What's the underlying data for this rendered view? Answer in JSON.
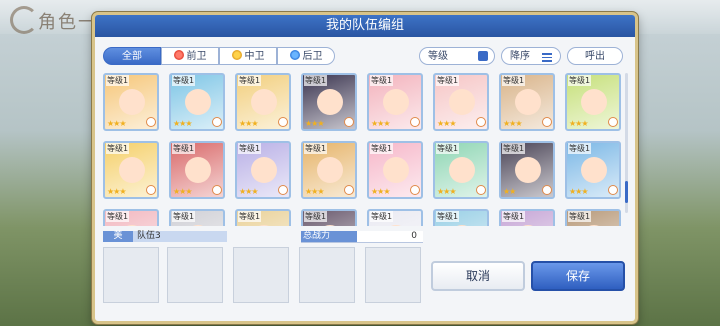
{
  "background": {
    "title": "角色一览"
  },
  "dialog": {
    "title": "我的队伍编组"
  },
  "filters": {
    "all": "全部",
    "front": "前卫",
    "mid": "中卫",
    "back": "后卫"
  },
  "controls": {
    "level_sort": "等级",
    "order": "降序",
    "call": "呼出"
  },
  "cards": {
    "r1": [
      {
        "level": "等级1",
        "stars": "★★★",
        "color": "#f6c77a"
      },
      {
        "level": "等级1",
        "stars": "★★★",
        "color": "#7fc6e6"
      },
      {
        "level": "等级1",
        "stars": "★★★",
        "color": "#f2cf7e"
      },
      {
        "level": "等级1",
        "stars": "★★★",
        "color": "#3b3550"
      },
      {
        "level": "等级1",
        "stars": "★★★",
        "color": "#f3b3bd"
      },
      {
        "level": "等级1",
        "stars": "★★★",
        "color": "#f6c6c6"
      },
      {
        "level": "等级1",
        "stars": "★★★",
        "color": "#d9b48a"
      },
      {
        "level": "等级1",
        "stars": "★★★",
        "color": "#c6e07a"
      }
    ],
    "r2": [
      {
        "level": "等级1",
        "stars": "★★★",
        "color": "#f5d06a"
      },
      {
        "level": "等级1",
        "stars": "★★★",
        "color": "#d96a6a"
      },
      {
        "level": "等级1",
        "stars": "★★★",
        "color": "#b9b0e6"
      },
      {
        "level": "等级1",
        "stars": "★★★",
        "color": "#e6b46a"
      },
      {
        "level": "等级1",
        "stars": "★★★",
        "color": "#f6b7c9"
      },
      {
        "level": "等级1",
        "stars": "★★★",
        "color": "#8fd6b4"
      },
      {
        "level": "等级1",
        "stars": "★★",
        "color": "#4a4456"
      },
      {
        "level": "等级1",
        "stars": "★★★",
        "color": "#7cb8e6"
      }
    ],
    "r3": [
      {
        "level": "等级1",
        "color": "#f2b8c0"
      },
      {
        "level": "等级1",
        "color": "#d0d0d6"
      },
      {
        "level": "等级1",
        "color": "#ead29a"
      },
      {
        "level": "等级1",
        "color": "#6a5a6e"
      },
      {
        "level": "等级1",
        "color": "#eaeaf2"
      },
      {
        "level": "等级1",
        "color": "#9ad0e6"
      },
      {
        "level": "等级1",
        "color": "#c6a6d6"
      },
      {
        "level": "等级1",
        "color": "#b89a7a"
      }
    ]
  },
  "team": {
    "label": "美",
    "name": "队伍3"
  },
  "power": {
    "label": "总战力",
    "value": "0"
  },
  "buttons": {
    "cancel": "取消",
    "save": "保存"
  }
}
